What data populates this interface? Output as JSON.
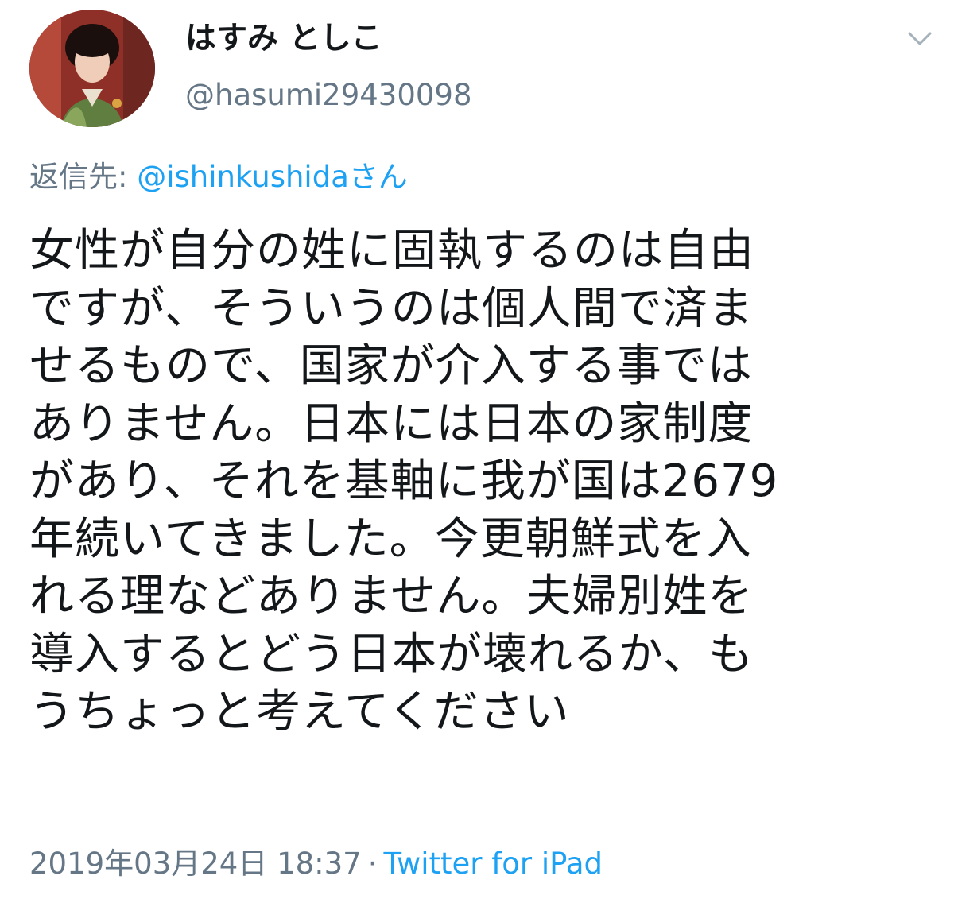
{
  "user": {
    "display_name": "はすみ としこ",
    "handle": "@hasumi29430098"
  },
  "reply": {
    "prefix": "返信先: ",
    "target": "@ishinkushidaさん"
  },
  "tweet": {
    "lines": [
      "女性が自分の姓に固執するのは自由",
      "ですが、そういうのは個人間で済ま",
      "せるもので、国家が介入する事では",
      "ありません。日本には日本の家制度",
      "があり、それを基軸に我が国は2679",
      "年続いてきました。今更朝鮮式を入",
      "れる理などありません。夫婦別姓を",
      "導入するとどう日本が壊れるか、も",
      "うちょっと考えてください"
    ]
  },
  "meta": {
    "timestamp": "2019年03月24日 18:37",
    "separator": "·",
    "source": "Twitter for iPad"
  },
  "icons": {
    "menu": "chevron-down-icon",
    "avatar": "profile-photo"
  },
  "colors": {
    "link": "#1da1f2",
    "secondary": "#657786",
    "text": "#14171a"
  }
}
